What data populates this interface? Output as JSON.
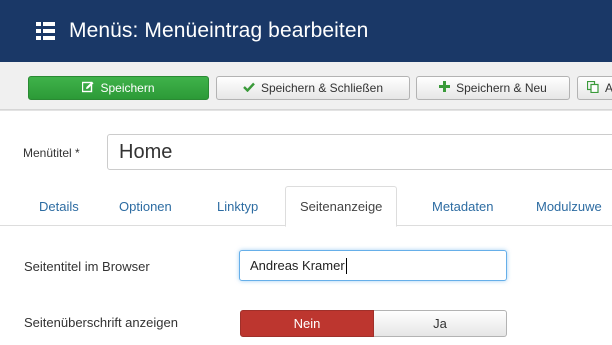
{
  "header": {
    "icon": "menu-list-icon",
    "title": "Menüs: Menüeintrag bearbeiten"
  },
  "toolbar": {
    "save_label": "Speichern",
    "save_icon": "edit-icon",
    "save_close_label": "Speichern & Schließen",
    "save_close_icon": "check-icon",
    "save_new_label": "Speichern & Neu",
    "save_new_icon": "plus-icon",
    "copy_label": "A",
    "copy_icon": "copy-icon"
  },
  "form": {
    "title_label": "Menütitel *",
    "title_value": "Home"
  },
  "tabs": [
    {
      "label": "Details"
    },
    {
      "label": "Optionen"
    },
    {
      "label": "Linktyp"
    },
    {
      "label": "Seitenanzeige",
      "active": true
    },
    {
      "label": "Metadaten"
    },
    {
      "label": "Modulzuwe"
    }
  ],
  "seitenanzeige": {
    "browser_title_label": "Seitentitel im Browser",
    "browser_title_value": "Andreas Kramer",
    "show_heading_label": "Seitenüberschrift anzeigen",
    "toggle_no": "Nein",
    "toggle_yes": "Ja",
    "selected": "Nein"
  },
  "colors": {
    "header_bg": "#1a3867",
    "save_green": "#34a53f",
    "no_red": "#bd362f",
    "link_blue": "#2d6ca2"
  }
}
